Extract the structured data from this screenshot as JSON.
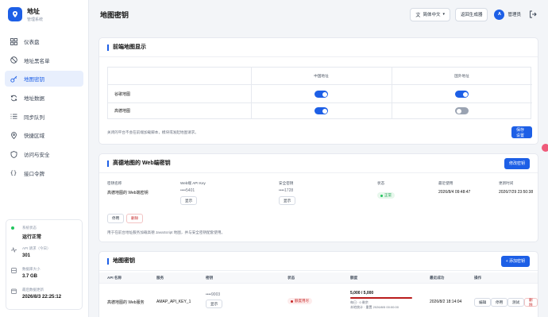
{
  "brand": {
    "title": "地址",
    "subtitle": "管理系统"
  },
  "sidebar": {
    "items": [
      {
        "label": "仪表盘",
        "icon": "grid-icon",
        "active": false
      },
      {
        "label": "地址黑名单",
        "icon": "ban-icon",
        "active": false
      },
      {
        "label": "地图密钥",
        "icon": "key-icon",
        "active": true
      },
      {
        "label": "地址数据",
        "icon": "refresh-icon",
        "active": false
      },
      {
        "label": "同步队列",
        "icon": "list-icon",
        "active": false
      },
      {
        "label": "快捷区域",
        "icon": "pin-icon",
        "active": false
      },
      {
        "label": "访问与安全",
        "icon": "shield-icon",
        "active": false
      },
      {
        "label": "接口令牌",
        "icon": "braces-icon",
        "active": false
      }
    ]
  },
  "status": {
    "system_label": "系统状态",
    "system_value": "运行正常",
    "api_label": "API 请求（今日）",
    "api_value": "301",
    "db_label": "数据库大小",
    "db_value": "3.7 GB",
    "updated_label": "最后数据更新",
    "updated_value": "2026/8/3 22:25:12"
  },
  "topbar": {
    "title": "地图密钥",
    "language": "简体中文",
    "back_button": "返回生成器",
    "avatar_letter": "A",
    "user": "管理员"
  },
  "frontend": {
    "title": "前端地图显示",
    "col_china": "中国地址",
    "col_foreign": "国外地址",
    "rows": [
      {
        "label": "谷歌地图",
        "china": true,
        "foreign": true
      },
      {
        "label": "高德地图",
        "china": true,
        "foreign": false
      }
    ],
    "note": "关闭的平台不会在前端加载脚本，模块或发起地图请求。",
    "save_button": "保存设置"
  },
  "web": {
    "title": "高德地图的 Web端密钥",
    "edit_button": "修改密钥",
    "cols": {
      "name": "密钥名称",
      "api": "Web端 API Key",
      "secret": "安全密钥",
      "state": "状态",
      "last_used": "最近使用",
      "updated": "更新时间"
    },
    "name": "高德地图的 Web端密钥",
    "api_masked": "••••5401",
    "secret_masked": "••••1728",
    "show": "显示",
    "state": "正常",
    "last_used": "2026/8/4 09:48:47",
    "updated": "2026/7/29 23:50:38",
    "disable_button": "停用",
    "delete_button": "删除",
    "note": "用于在前台地址服务加载高德 JavaScript 地图，并与安全密钥配套使用。"
  },
  "keys": {
    "title": "地图密钥",
    "add_button": "+ 添加密钥",
    "headers": [
      "API 名称",
      "服务",
      "密钥",
      "状态",
      "额度",
      "最近成功",
      "操作"
    ],
    "rows": [
      {
        "name": "高德地图的 Web服务",
        "service": "AMAP_API_KEY_1",
        "key_masked": "••••9003",
        "show": "显示",
        "state": "额度用尽",
        "quota": "5,000 / 5,000",
        "quota_fraction": 1.0,
        "quota_note1": "每日 · 0 剩余",
        "quota_note2": "本地统计 · 重置 2026/8/5 00:00:00",
        "last_success": "2026/8/2 18:14:04",
        "actions": [
          "编辑",
          "停用",
          "测试",
          "删除"
        ]
      }
    ]
  },
  "colors": {
    "accent": "#1d5fe6",
    "success": "#16a34a",
    "danger": "#c62828"
  }
}
